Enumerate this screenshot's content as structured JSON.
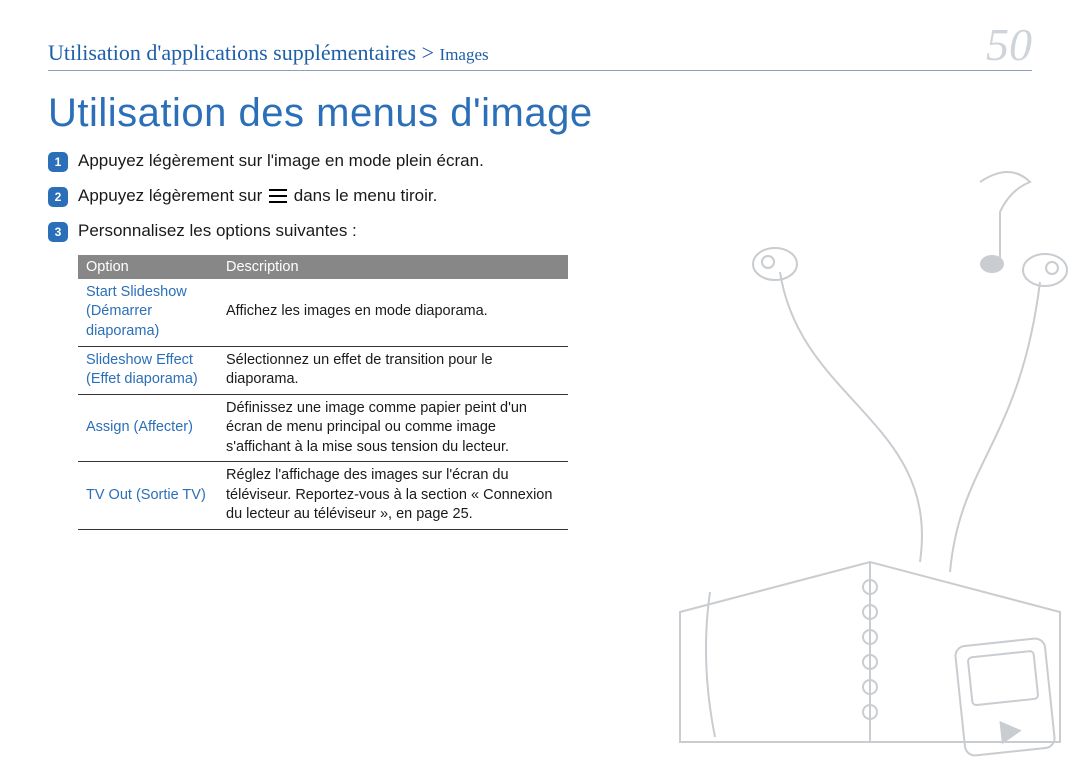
{
  "header": {
    "breadcrumb_main": "Utilisation d'applications supplémentaires",
    "breadcrumb_sep": " > ",
    "breadcrumb_sub": "Images",
    "page_number": "50"
  },
  "heading": "Utilisation des menus d'image",
  "steps": [
    {
      "num": "1",
      "text": "Appuyez légèrement sur l'image en mode plein écran."
    },
    {
      "num": "2",
      "text_before": "Appuyez légèrement sur ",
      "text_after": " dans le menu tiroir.",
      "has_icon": true
    },
    {
      "num": "3",
      "text": "Personnalisez les options suivantes :"
    }
  ],
  "table": {
    "head": {
      "col1": "Option",
      "col2": "Description"
    },
    "rows": [
      {
        "option": "Start Slideshow (Démarrer diaporama)",
        "desc": "Affichez les images en mode diaporama."
      },
      {
        "option": "Slideshow Effect (Effet diaporama)",
        "desc": "Sélectionnez un effet de transition pour le diaporama."
      },
      {
        "option": "Assign (Affecter)",
        "desc": "Définissez une image comme papier peint d'un écran de menu principal ou comme image s'affichant à la mise sous tension du lecteur."
      },
      {
        "option": "TV Out (Sortie TV)",
        "desc": "Réglez l'affichage des images sur l'écran du téléviseur. Reportez-vous à la section « Connexion du lecteur au téléviseur », en page 25."
      }
    ]
  },
  "icons": {
    "menu": "hamburger-icon"
  }
}
